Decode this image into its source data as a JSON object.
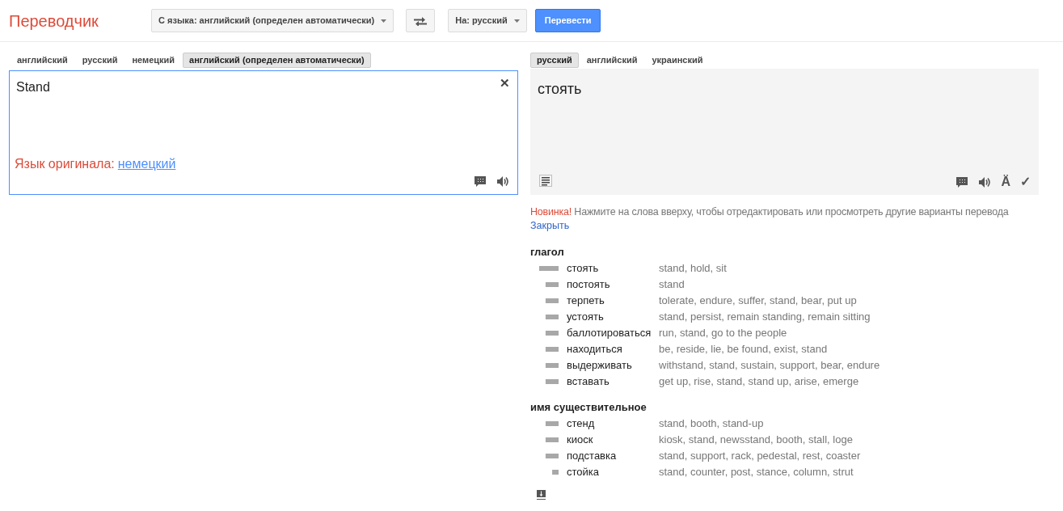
{
  "header": {
    "logo": "Переводчик",
    "source_select": "С языка: английский (определен автоматически)",
    "target_select": "На: русский",
    "translate_button": "Перевести"
  },
  "source": {
    "tabs": [
      {
        "label": "английский",
        "selected": false
      },
      {
        "label": "русский",
        "selected": false
      },
      {
        "label": "немецкий",
        "selected": false
      },
      {
        "label": "английский (определен автоматически)",
        "selected": true
      }
    ],
    "text": "Stand",
    "clear": "✕",
    "detected_label": "Язык оригинала:",
    "detected_link": "немецкий"
  },
  "target": {
    "tabs": [
      {
        "label": "русский",
        "selected": true
      },
      {
        "label": "английский",
        "selected": false
      },
      {
        "label": "украинский",
        "selected": false
      }
    ],
    "text": "стоять",
    "accent": "Ä",
    "check": "✓"
  },
  "notice": {
    "new": "Новинка!",
    "text": "Нажмите на слова вверху, чтобы отредактировать или просмотреть другие варианты перевода",
    "close": "Закрыть"
  },
  "dictionary": [
    {
      "part": "глагол",
      "entries": [
        {
          "word": "стоять",
          "level": 1,
          "meanings": "stand, hold, sit"
        },
        {
          "word": "постоять",
          "level": 0.67,
          "meanings": "stand"
        },
        {
          "word": "терпеть",
          "level": 0.67,
          "meanings": "tolerate, endure, suffer, stand, bear, put up"
        },
        {
          "word": "устоять",
          "level": 0.67,
          "meanings": "stand, persist, remain standing, remain sitting"
        },
        {
          "word": "баллотироваться",
          "level": 0.67,
          "meanings": "run, stand, go to the people"
        },
        {
          "word": "находиться",
          "level": 0.67,
          "meanings": "be, reside, lie, be found, exist, stand"
        },
        {
          "word": "выдерживать",
          "level": 0.67,
          "meanings": "withstand, stand, sustain, support, bear, endure"
        },
        {
          "word": "вставать",
          "level": 0.67,
          "meanings": "get up, rise, stand, stand up, arise, emerge"
        }
      ]
    },
    {
      "part": "имя существительное",
      "entries": [
        {
          "word": "стенд",
          "level": 0.67,
          "meanings": "stand, booth, stand-up"
        },
        {
          "word": "киоск",
          "level": 0.67,
          "meanings": "kiosk, stand, newsstand, booth, stall, loge"
        },
        {
          "word": "подставка",
          "level": 0.67,
          "meanings": "stand, support, rack, pedestal, rest, coaster"
        },
        {
          "word": "стойка",
          "level": 0.33,
          "meanings": "stand, counter, post, stance, column, strut"
        }
      ]
    }
  ]
}
